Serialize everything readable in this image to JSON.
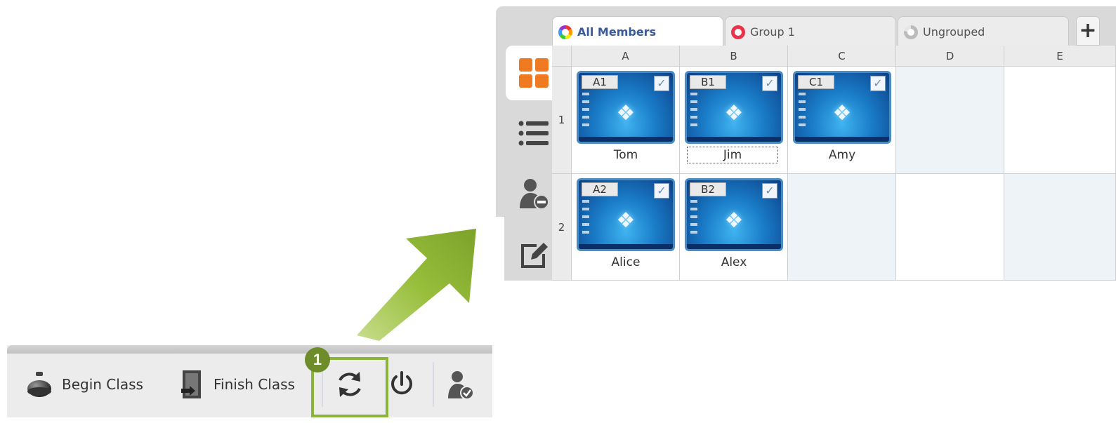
{
  "tabs": [
    {
      "label": "All Members",
      "active": true,
      "icon": "rainbow-ring-icon"
    },
    {
      "label": "Group 1",
      "active": false,
      "icon": "red-ring-icon"
    },
    {
      "label": "Ungrouped",
      "active": false,
      "icon": "gray-ring-icon"
    }
  ],
  "add_tab_label": "+",
  "side_tabs": [
    {
      "icon": "thumbnail-view-icon",
      "active": true
    },
    {
      "icon": "list-view-icon",
      "active": false
    },
    {
      "icon": "user-remove-icon",
      "active": false
    },
    {
      "icon": "edit-icon",
      "active": false
    }
  ],
  "grid": {
    "columns": [
      "A",
      "B",
      "C",
      "D",
      "E"
    ],
    "rows": [
      "1",
      "2"
    ],
    "members": [
      {
        "seat": "A1",
        "name": "Tom",
        "col": 0,
        "row": 0,
        "checked": true
      },
      {
        "seat": "B1",
        "name": "Jim",
        "col": 1,
        "row": 0,
        "checked": true,
        "focused": true
      },
      {
        "seat": "C1",
        "name": "Amy",
        "col": 2,
        "row": 0,
        "checked": true
      },
      {
        "seat": "A2",
        "name": "Alice",
        "col": 0,
        "row": 1,
        "checked": true
      },
      {
        "seat": "B2",
        "name": "Alex",
        "col": 1,
        "row": 1,
        "checked": true
      }
    ]
  },
  "toolbar": {
    "begin_class": "Begin Class",
    "finish_class": "Finish Class",
    "callout_number": "1"
  },
  "colors": {
    "accent_green": "#8cb33a",
    "badge_green": "#6e8d2a",
    "thumb_border": "#4a8cc2",
    "active_tab_text": "#3a5a9a"
  }
}
